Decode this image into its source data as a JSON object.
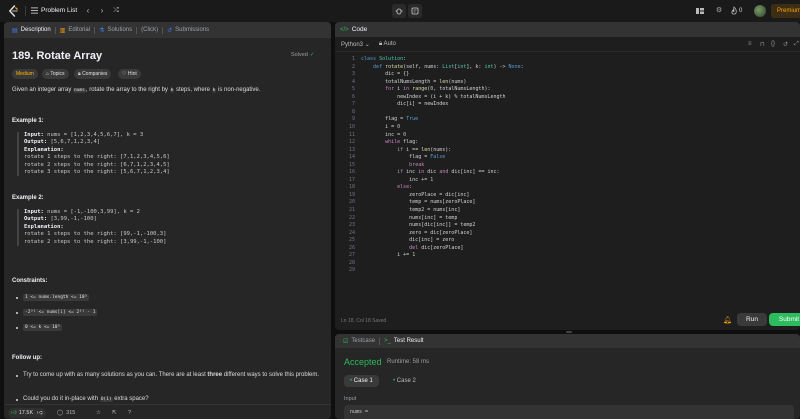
{
  "topbar": {
    "title": "Problem List",
    "coin_count": "0",
    "premium_label": "Premium"
  },
  "left_tabs": [
    {
      "label": "Description",
      "icon": "document-icon"
    },
    {
      "label": "Editorial",
      "icon": "book-icon"
    },
    {
      "label": "Solutions",
      "icon": "flask-icon"
    },
    {
      "label": "(Click)",
      "icon": ""
    },
    {
      "label": "Submissions",
      "icon": "history-icon"
    }
  ],
  "problem": {
    "title": "189. Rotate Array",
    "status": "Solved",
    "chips": [
      "Medium",
      "Topics",
      "Companies",
      "Hint"
    ],
    "desc_part1": "Given an integer array ",
    "desc_code1": "nums",
    "desc_part2": ", rotate the array to the right by ",
    "desc_code2": "k",
    "desc_part3": " steps, where ",
    "desc_code3": "k",
    "desc_part4": " is non-negative."
  },
  "example1": {
    "heading": "Example 1:",
    "input_label": "Input:",
    "input_val": " nums = [1,2,3,4,5,6,7], k = 3",
    "output_label": "Output:",
    "output_val": " [5,6,7,1,2,3,4]",
    "expl_label": "Explanation:",
    "lines": [
      "rotate 1 steps to the right: [7,1,2,3,4,5,6]",
      "rotate 2 steps to the right: [6,7,1,2,3,4,5]",
      "rotate 3 steps to the right: [5,6,7,1,2,3,4]"
    ]
  },
  "example2": {
    "heading": "Example 2:",
    "input_label": "Input:",
    "input_val": " nums = [-1,-100,3,99], k = 2",
    "output_label": "Output:",
    "output_val": " [3,99,-1,-100]",
    "expl_label": "Explanation:",
    "lines": [
      "rotate 1 steps to the right: [99,-1,-100,3]",
      "rotate 2 steps to the right: [3,99,-1,-100]"
    ]
  },
  "constraints": {
    "heading": "Constraints:",
    "items": [
      "1 <= nums.length <= 10⁵",
      "-2³¹ <= nums[i] <= 2³¹ - 1",
      "0 <= k <= 10⁵"
    ]
  },
  "followup": {
    "heading": "Follow up:",
    "item1_a": "Try to come up with as many solutions as you can. There are at least ",
    "item1_b": "three",
    "item1_c": " different ways to solve this problem.",
    "item2_a": "Could you do it in-place with ",
    "item2_code": "O(1)",
    "item2_b": " extra space?"
  },
  "left_bottom": {
    "likes": "17.5K",
    "comments": "315"
  },
  "code_panel": {
    "title": "Code",
    "language": "Python3",
    "auto_label": "Auto",
    "status": "Ln 18, Col 18   Saved",
    "run_label": "Run",
    "submit_label": "Submit"
  },
  "code_lines": [
    "class Solution:",
    "    def rotate(self, nums: List[int], k: int) -> None:",
    "        dic = {}",
    "        totalNumsLength = len(nums)",
    "        for i in range(0, totalNumsLength):",
    "            newIndex = (i + k) % totalNumsLength",
    "            dic[i] = newIndex",
    "",
    "        flag = True",
    "        i = 0",
    "        inc = 0",
    "        while flag:",
    "            if i == len(nums):",
    "                flag = False",
    "                break",
    "            if inc in dic and dic[inc] == inc:",
    "                inc += 1",
    "            else:",
    "                zeroPlace = dic[inc]",
    "                temp = nums[zeroPlace]",
    "                temp2 = nums[inc]",
    "                nums[inc] = temp",
    "                nums[dic[inc]] = temp2",
    "                zero = dic[zeroPlace]",
    "                dic[inc] = zero",
    "                del dic[zeroPlace]",
    "            i += 1",
    "",
    ""
  ],
  "test_panel": {
    "tab1": "Testcase",
    "tab2": "Test Result",
    "result": "Accepted",
    "runtime": "Runtime: 58 ms",
    "case1": "Case 1",
    "case2": "Case 2",
    "input_label": "Input",
    "input_value": "nums ="
  },
  "colors": {
    "accent_green": "#2cbb5d",
    "medium": "#ffb800",
    "premium": "#ffa116"
  }
}
